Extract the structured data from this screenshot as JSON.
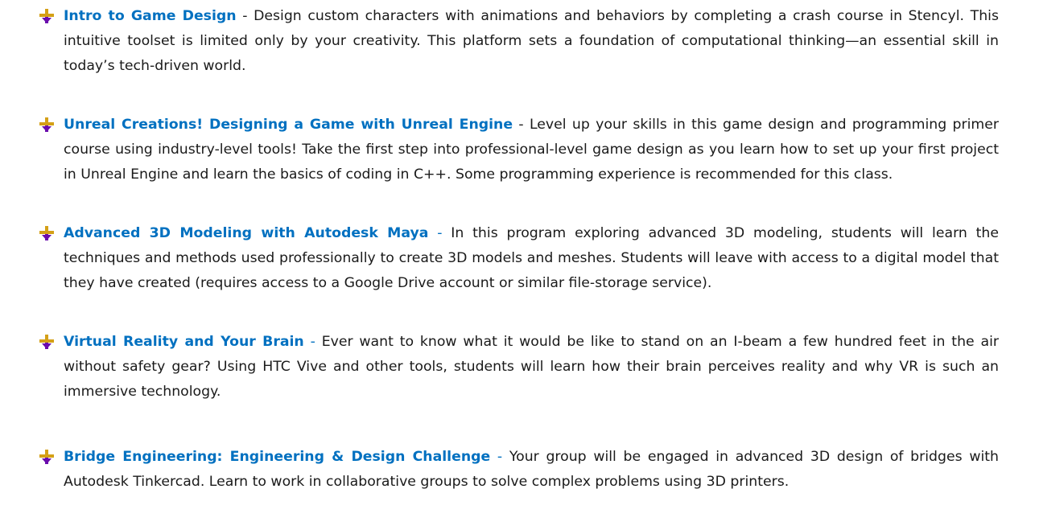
{
  "colors": {
    "title": "#0070c0",
    "body_text": "#1a1a1a",
    "bullet_cross": "#d4a017",
    "bullet_arrow": "#6a0dad"
  },
  "bullet_icon": "plus-with-down-arrow-icon",
  "courses": [
    {
      "title": "Intro to Game Design",
      "separator": " - ",
      "description": "Design custom characters with animations and behaviors by completing a crash course in Stencyl. This intuitive toolset is limited only by your creativity. This platform sets a foundation of computational thinking—an essential skill in today’s tech-driven world."
    },
    {
      "title": "Unreal Creations! Designing a Game with Unreal Engine",
      "separator": " - ",
      "description": "Level up your skills in this game design and programming primer course using industry-level tools! Take the first step into professional-level game design as you learn how to set up your first project in Unreal Engine and learn the basics of coding in C++. Some programming experience is recommended for this class."
    },
    {
      "title": "Advanced 3D Modeling with Autodesk Maya",
      "separator": " - ",
      "description": "In this program exploring advanced 3D modeling, students will learn the techniques and methods used professionally to create 3D models and meshes. Students will leave with access to a digital model that they have created (requires access to a Google Drive account or similar file-storage service)."
    },
    {
      "title": "Virtual Reality and Your Brain",
      "separator": " - ",
      "description": "Ever want to know what it would be like to stand on an I-beam a few hundred feet in the air without safety gear?  Using HTC Vive and other tools, students will learn how their brain perceives reality and why VR is such an immersive technology."
    },
    {
      "title": "Bridge Engineering: Engineering & Design Challenge",
      "separator": " - ",
      "description": "Your group will be engaged in advanced 3D design of bridges with Autodesk Tinkercad. Learn to work in collaborative groups to solve complex problems using 3D printers."
    }
  ]
}
